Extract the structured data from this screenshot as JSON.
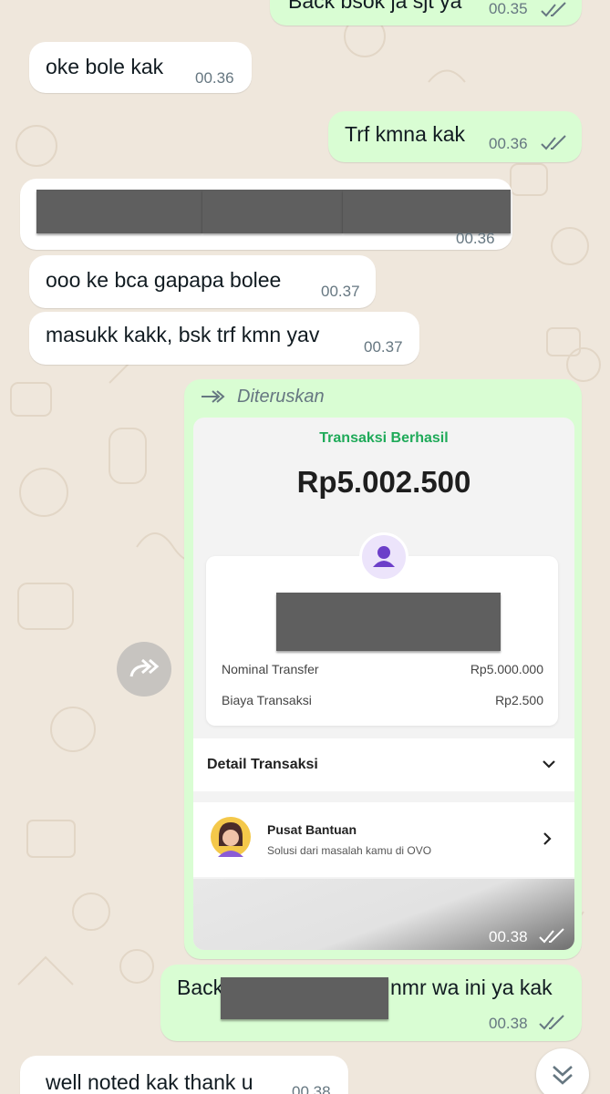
{
  "messages": {
    "m0": {
      "text": "Back bsok ja sjt ya",
      "time": "00.35"
    },
    "m1": {
      "text": "oke bole kak",
      "time": "00.36"
    },
    "m2": {
      "text": "Trf kmna kak",
      "time": "00.36"
    },
    "m3": {
      "time": "00.36"
    },
    "m4": {
      "text": "ooo ke bca gapapa bolee",
      "time": "00.37"
    },
    "m5": {
      "text": "masukk kakk, bsk trf kmn yav",
      "time": "00.37"
    },
    "m6": {
      "forwarded_label": "Diteruskan",
      "time": "00.38",
      "receipt": {
        "status": "Transaksi Berhasil",
        "amount": "Rp5.002.500",
        "nominal_label": "Nominal Transfer",
        "nominal_value": "Rp5.000.000",
        "fee_label": "Biaya Transaksi",
        "fee_value": "Rp2.500",
        "detail_label": "Detail Transaksi",
        "help_title": "Pusat Bantuan",
        "help_subtitle": "Solusi dari masalah kamu di OVO"
      }
    },
    "m7": {
      "text_start": "Back",
      "text_end": "nmr wa ini ya kak",
      "time": "00.38"
    },
    "m8": {
      "text": "well noted kak thank u",
      "time": "00.38"
    }
  },
  "colors": {
    "chat_background": "#efe7dc",
    "outgoing_bubble": "#d9fdd3",
    "incoming_bubble": "#ffffff",
    "read_ticks": "#667781",
    "receipt_status_green": "#1faa59",
    "avatar_purple": "#6c3fc9"
  },
  "icons": {
    "forward": "forward-icon",
    "share": "share-forward-icon",
    "scroll": "chevron-double-down-icon",
    "detail_toggle": "chevron-down-icon",
    "help_arrow": "chevron-right-icon",
    "avatar": "user-avatar-icon",
    "support_agent": "support-agent-avatar"
  }
}
